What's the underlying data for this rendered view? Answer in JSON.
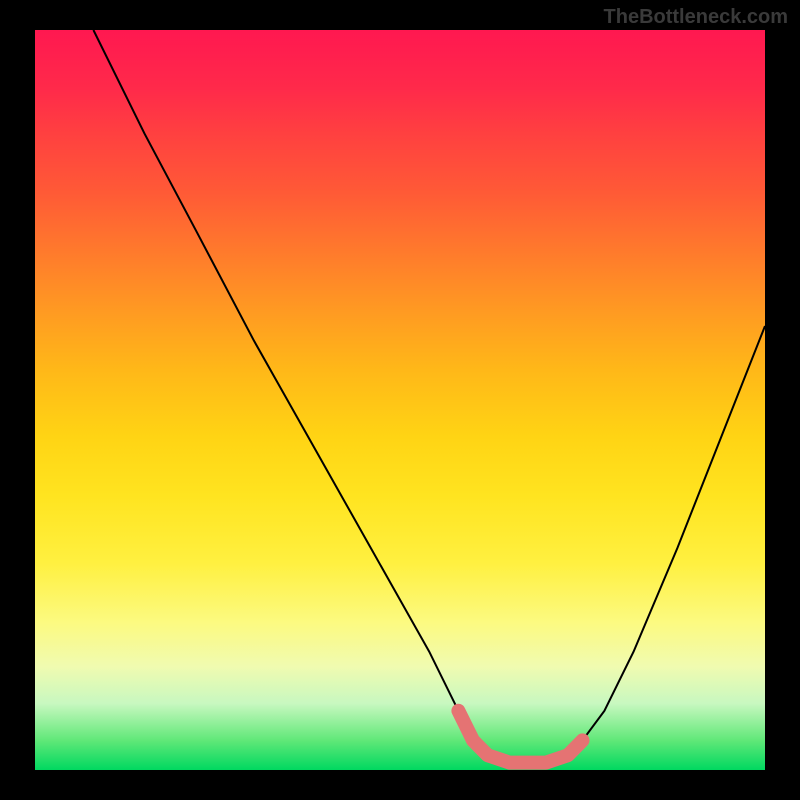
{
  "watermark": "TheBottleneck.com",
  "chart_data": {
    "type": "line",
    "title": "",
    "xlabel": "",
    "ylabel": "",
    "xlim": [
      0,
      100
    ],
    "ylim": [
      0,
      100
    ],
    "grid": false,
    "legend": false,
    "series": [
      {
        "name": "curve",
        "color": "#000000",
        "x": [
          8,
          15,
          22,
          30,
          38,
          46,
          54,
          58,
          60,
          62,
          65,
          70,
          73,
          75,
          78,
          82,
          88,
          94,
          100
        ],
        "y": [
          100,
          86,
          73,
          58,
          44,
          30,
          16,
          8,
          4,
          2,
          1,
          1,
          2,
          4,
          8,
          16,
          30,
          45,
          60
        ]
      },
      {
        "name": "highlight",
        "color": "#e57373",
        "x": [
          58,
          60,
          62,
          65,
          70,
          73,
          75
        ],
        "y": [
          8,
          4,
          2,
          1,
          1,
          2,
          4
        ]
      }
    ],
    "gradient_stops": [
      {
        "pos": 0,
        "color": "#ff1850"
      },
      {
        "pos": 8,
        "color": "#ff2a4a"
      },
      {
        "pos": 14,
        "color": "#ff4040"
      },
      {
        "pos": 22,
        "color": "#ff5a36"
      },
      {
        "pos": 30,
        "color": "#ff7a2c"
      },
      {
        "pos": 38,
        "color": "#ff9a22"
      },
      {
        "pos": 46,
        "color": "#ffb818"
      },
      {
        "pos": 55,
        "color": "#ffd414"
      },
      {
        "pos": 63,
        "color": "#ffe420"
      },
      {
        "pos": 72,
        "color": "#fff040"
      },
      {
        "pos": 80,
        "color": "#fcfa80"
      },
      {
        "pos": 86,
        "color": "#f0fbb0"
      },
      {
        "pos": 91,
        "color": "#c8f8c0"
      },
      {
        "pos": 96,
        "color": "#60e878"
      },
      {
        "pos": 100,
        "color": "#00d860"
      }
    ]
  }
}
